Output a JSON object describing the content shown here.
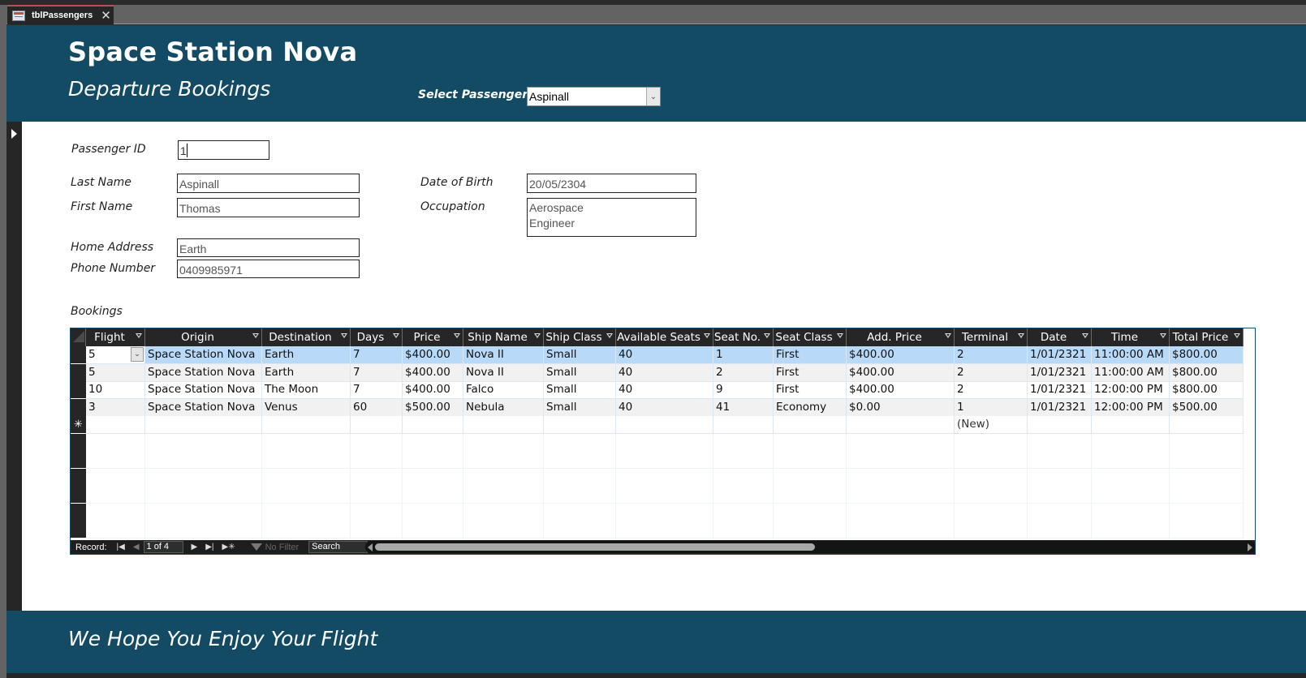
{
  "tab": {
    "label": "tblPassengers",
    "icon": "form-icon",
    "close": "✕"
  },
  "header": {
    "title": "Space Station Nova",
    "subtitle": "Departure Bookings",
    "select_label": "Select Passenger",
    "select_value": "Aspinall"
  },
  "fields": {
    "passenger_id": {
      "label": "Passenger ID",
      "value": "1"
    },
    "last_name": {
      "label": "Last Name",
      "value": "Aspinall"
    },
    "first_name": {
      "label": "First Name",
      "value": "Thomas"
    },
    "home_address": {
      "label": "Home Address",
      "value": "Earth"
    },
    "phone_number": {
      "label": "Phone Number",
      "value": "0409985971"
    },
    "date_of_birth": {
      "label": "Date of Birth",
      "value": "20/05/2304"
    },
    "occupation": {
      "label": "Occupation",
      "value": "Aerospace\nEngineer"
    }
  },
  "bookings": {
    "label": "Bookings",
    "columns": [
      "Flight",
      "Origin",
      "Destination",
      "Days",
      "Price",
      "Ship Name",
      "Ship Class",
      "Available Seats",
      "Seat No.",
      "Seat Class",
      "Add. Price",
      "Terminal",
      "Date",
      "Time",
      "Total Price"
    ],
    "rows": [
      [
        "5",
        "Space Station Nova",
        "Earth",
        "7",
        "$400.00",
        "Nova II",
        "Small",
        "40",
        "1",
        "First",
        "$400.00",
        "2",
        "1/01/2321",
        "11:00:00 AM",
        "$800.00"
      ],
      [
        "5",
        "Space Station Nova",
        "Earth",
        "7",
        "$400.00",
        "Nova II",
        "Small",
        "40",
        "2",
        "First",
        "$400.00",
        "2",
        "1/01/2321",
        "11:00:00 AM",
        "$800.00"
      ],
      [
        "10",
        "Space Station Nova",
        "The Moon",
        "7",
        "$400.00",
        "Falco",
        "Small",
        "40",
        "9",
        "First",
        "$400.00",
        "2",
        "1/01/2321",
        "12:00:00 PM",
        "$800.00"
      ],
      [
        "3",
        "Space Station Nova",
        "Venus",
        "60",
        "$500.00",
        "Nebula",
        "Small",
        "40",
        "41",
        "Economy",
        "$0.00",
        "1",
        "1/01/2321",
        "12:00:00 PM",
        "$500.00"
      ]
    ],
    "new_row_terminal": "(New)",
    "new_row_marker": "✳",
    "navigation": {
      "record_label": "Record:",
      "position": "1 of 4",
      "filter_label": "No Filter",
      "search_label": "Search"
    }
  },
  "footer": {
    "text": "We Hope You Enjoy Your Flight"
  },
  "colors": {
    "brand": "#134a64",
    "selected_row": "#b8d9f8",
    "header_bg": "#262626"
  }
}
